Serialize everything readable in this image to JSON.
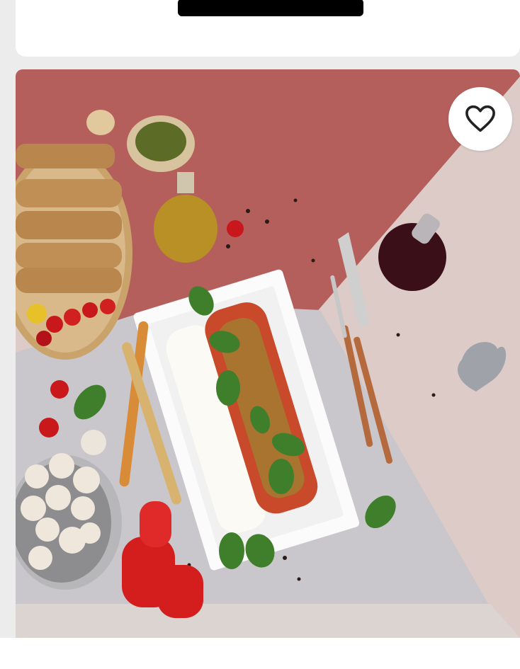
{
  "app": {
    "top_card": {
      "bar_color": "#000000"
    },
    "product_card": {
      "image_alt_name": "food-photo",
      "favorite": {
        "icon": "heart-outline-icon",
        "active": false
      }
    }
  }
}
